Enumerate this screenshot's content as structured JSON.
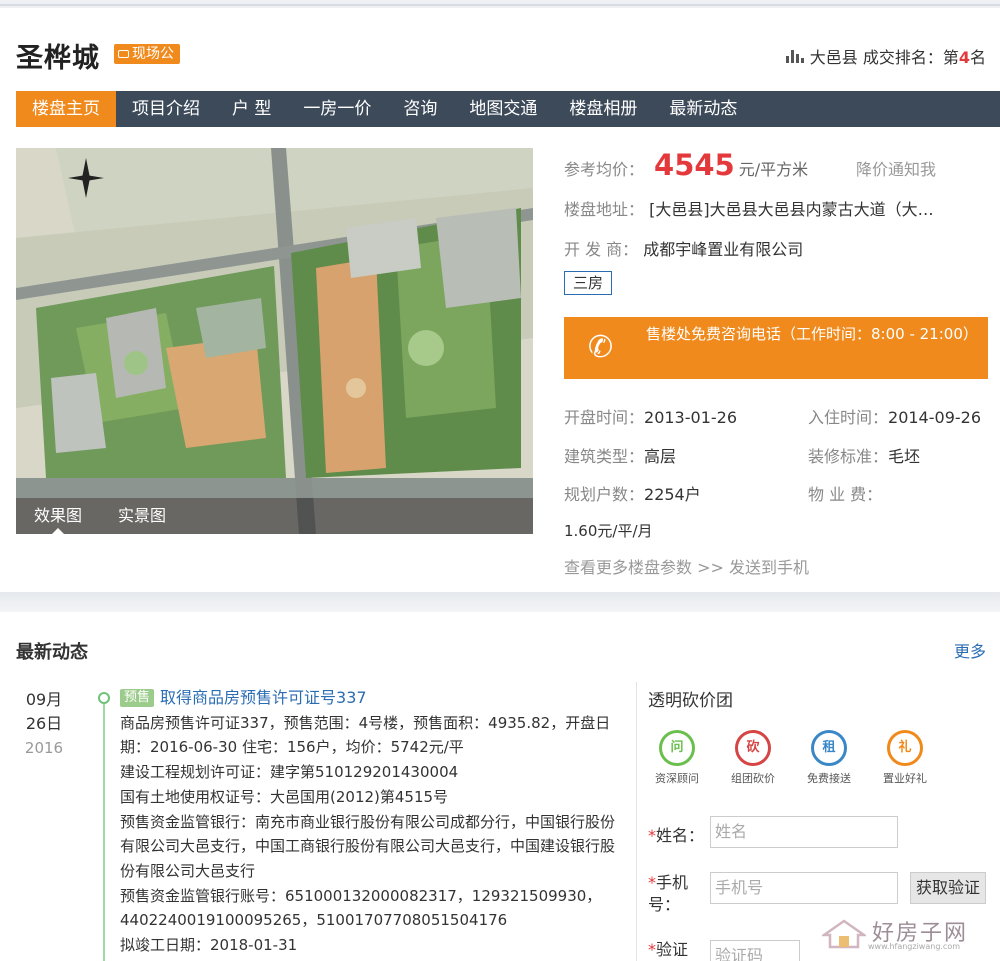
{
  "header": {
    "title": "圣桦城",
    "onsite_badge": "现场公",
    "rank_prefix": "大邑县 成交排名：第",
    "rank_num": "4",
    "rank_suffix": "名"
  },
  "nav": [
    "楼盘主页",
    "项目介绍",
    "户 型",
    "一房一价",
    "咨询",
    "地图交通",
    "楼盘相册",
    "最新动态"
  ],
  "photo_tabs": [
    "效果图",
    "实景图"
  ],
  "info": {
    "price_label": "参考均价：",
    "price": "4545",
    "price_unit": "元/平方米",
    "notify": "降价通知我",
    "addr_label": "楼盘地址：",
    "addr": "[大邑县]大邑县大邑县内蒙古大道（大…",
    "dev_label": "开 发 商：",
    "dev": "成都宇峰置业有限公司",
    "tag": "三房",
    "phone_text": "售楼处免费咨询电话（工作时间：8:00 - 21:00）",
    "open_label": "开盘时间：",
    "open": "2013-01-26",
    "move_label": "入住时间：",
    "move": "2014-09-26",
    "type_label": "建筑类型：",
    "type": "高层",
    "deco_label": "装修标准：",
    "deco": "毛坯",
    "households_label": "规划户数：",
    "households": "2254户",
    "fee_label": "物 业 费：",
    "fee": "1.60元/平/月",
    "more": "查看更多楼盘参数 >> 发送到手机"
  },
  "news": {
    "title": "最新动态",
    "more": "更多",
    "date": "09月26日",
    "year": "2016",
    "tag": "预售",
    "headline": "取得商品房预售许可证号337",
    "lines": [
      "商品房预售许可证337，预售范围：4号楼，预售面积：4935.82，开盘日期：2016-06-30 住宅：156户，均价：5742元/平",
      "建设工程规划许可证：建字第510129201430004",
      "国有土地使用权证号：大邑国用(2012)第4515号",
      "预售资金监管银行：南充市商业银行股份有限公司成都分行，中国银行股份有限公司大邑支行，中国工商银行股份有限公司大邑支行，中国建设银行股份有限公司大邑支行",
      "预售资金监管银行账号：651000132000082317，129321509930，4402240019100095265，51001707708051504176",
      "拟竣工日期：2018-01-31"
    ]
  },
  "group": {
    "title": "透明砍价团",
    "icons": [
      {
        "char": "问",
        "label": "资深顾问",
        "color": "#6bbf4e"
      },
      {
        "char": "砍",
        "label": "组团砍价",
        "color": "#d64545"
      },
      {
        "char": "租",
        "label": "免费接送",
        "color": "#3a87c8"
      },
      {
        "char": "礼",
        "label": "置业好礼",
        "color": "#f08a1c"
      }
    ],
    "name_label": "*姓名：",
    "name_ph": "姓名",
    "phone_label": "*手机号：",
    "phone_ph": "手机号",
    "code_btn": "获取验证",
    "code_label": "*验证",
    "code_ph": "验证码"
  },
  "watermark": {
    "text": "好房子网",
    "sub": "www.hfangziwang.com"
  },
  "colors": {
    "accent": "#f08a1c",
    "nav_bg": "#3d4a5a",
    "price": "#e4393c",
    "link": "#2b6db3"
  }
}
